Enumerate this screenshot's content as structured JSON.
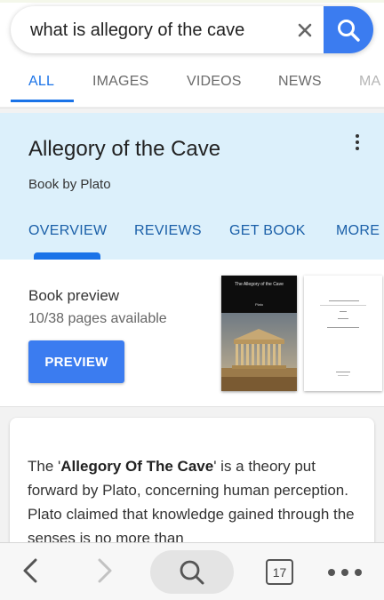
{
  "search": {
    "query": "what is allegory of the cave",
    "clear_icon": "close-icon",
    "search_icon": "search-icon"
  },
  "tabs": [
    {
      "label": "ALL",
      "active": true
    },
    {
      "label": "IMAGES",
      "active": false
    },
    {
      "label": "VIDEOS",
      "active": false
    },
    {
      "label": "NEWS",
      "active": false
    },
    {
      "label": "MA",
      "active": false
    }
  ],
  "knowledge_panel": {
    "title": "Allegory of the Cave",
    "subtitle": "Book by Plato",
    "menu_icon": "more-vert-icon",
    "tabs": [
      {
        "label": "OVERVIEW",
        "active": true
      },
      {
        "label": "REVIEWS",
        "active": false
      },
      {
        "label": "GET BOOK",
        "active": false
      },
      {
        "label": "MORE",
        "active": false
      }
    ]
  },
  "book_preview": {
    "heading": "Book preview",
    "pages": "10/38 pages available",
    "button_label": "PREVIEW",
    "cover_title": "The Allegory of the Cave",
    "cover_author": "Plato"
  },
  "description": {
    "prefix": "The '",
    "bold_term": "Allegory Of The Cave",
    "suffix": "' is a theory put forward by Plato, concerning human perception. Plato claimed that knowledge gained through the senses is no more than"
  },
  "bottom_bar": {
    "back_icon": "chevron-left-icon",
    "forward_icon": "chevron-right-icon",
    "search_icon": "search-icon",
    "tab_count": "17",
    "more_icon": "more-horiz-icon"
  },
  "colors": {
    "accent": "#1a73e8",
    "search_button": "#3b7cf0",
    "panel_background": "#dcf0fb"
  }
}
